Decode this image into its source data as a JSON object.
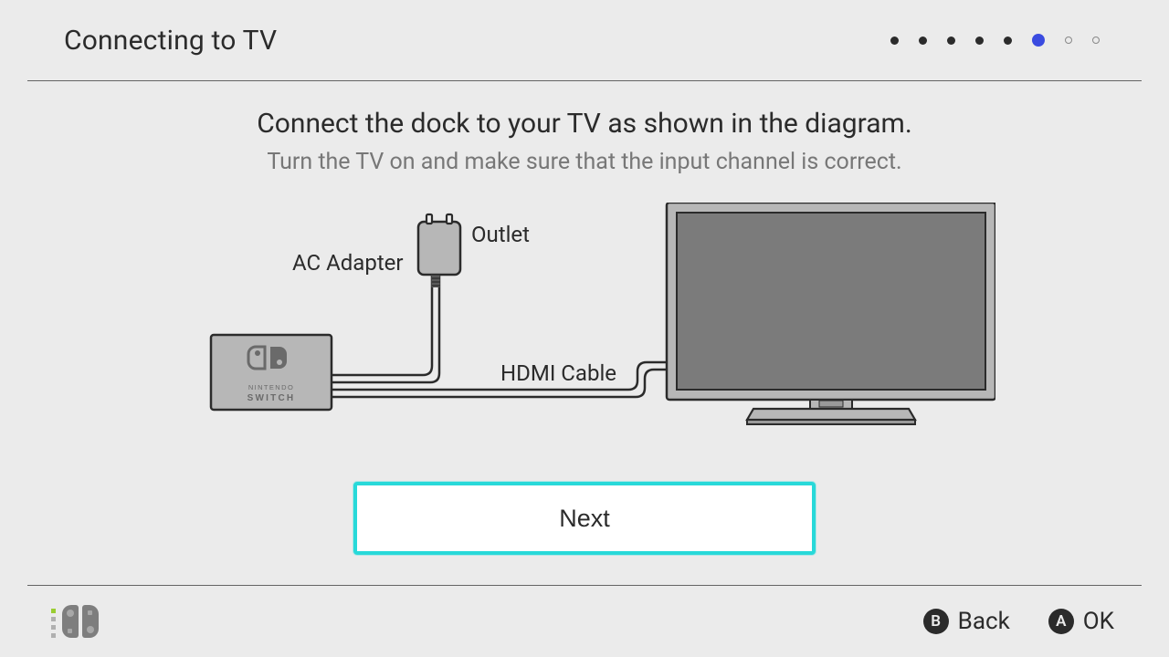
{
  "header": {
    "title": "Connecting to TV",
    "progress": {
      "total": 8,
      "current": 6
    }
  },
  "content": {
    "heading": "Connect the dock to your TV as shown in the diagram.",
    "subheading": "Turn the TV on and make sure that the input channel is correct.",
    "next_label": "Next"
  },
  "diagram": {
    "outlet_label": "Outlet",
    "ac_adapter_label": "AC Adapter",
    "hdmi_cable_label": "HDMI Cable",
    "dock_brand_top": "NINTENDO",
    "dock_brand_bottom": "SWITCH"
  },
  "footer": {
    "back_button": "B",
    "back_label": "Back",
    "ok_button": "A",
    "ok_label": "OK"
  }
}
